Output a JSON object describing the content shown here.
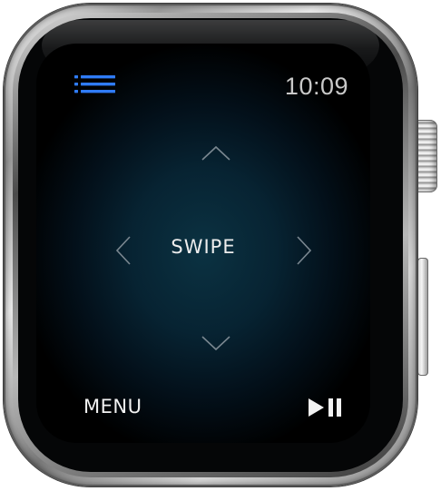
{
  "status_bar": {
    "time": "10:09"
  },
  "remote": {
    "swipe_label": "SWIPE"
  },
  "footer": {
    "menu_label": "MENU",
    "playpause_icon": "play-pause-icon"
  },
  "colors": {
    "accent_blue": "#2f7bf6",
    "screen_glow": "#0b3242",
    "text": "#ededed",
    "chevron": "#7a8790"
  }
}
